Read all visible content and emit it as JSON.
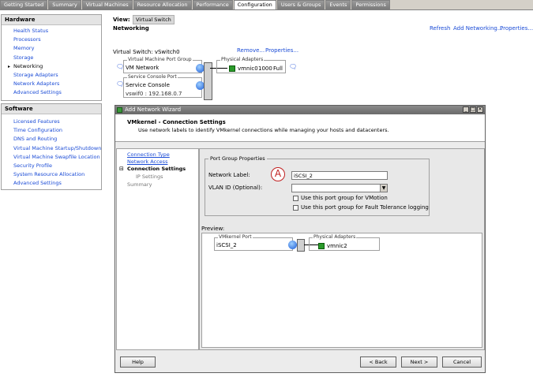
{
  "tabs": [
    "Getting Started",
    "Summary",
    "Virtual Machines",
    "Resource Allocation",
    "Performance",
    "Configuration",
    "Users & Groups",
    "Events",
    "Permissions"
  ],
  "active_tab": "Configuration",
  "hardware": {
    "title": "Hardware",
    "items": [
      "Health Status",
      "Processors",
      "Memory",
      "Storage",
      "Networking",
      "Storage Adapters",
      "Network Adapters",
      "Advanced Settings"
    ]
  },
  "software": {
    "title": "Software",
    "items": [
      "Licensed Features",
      "Time Configuration",
      "DNS and Routing",
      "Virtual Machine Startup/Shutdown",
      "Virtual Machine Swapfile Location",
      "Security Profile",
      "System Resource Allocation",
      "Advanced Settings"
    ]
  },
  "main": {
    "view_label": "View:",
    "view_value": "Virtual Switch",
    "section_title": "Networking",
    "refresh": "Refresh",
    "add_networking": "Add Networking...",
    "properties": "Properties...",
    "vswitch_label": "Virtual Switch: vSwitch0",
    "remove": "Remove...",
    "vswitch_properties": "Properties...",
    "vm_port_group_label": "Virtual Machine Port Group",
    "vm_network": "VM Network",
    "service_console_port_label": "Service Console Port",
    "service_console": "Service Console",
    "vswif": "vswif0 : 192.168.0.7",
    "physical_adapters_label": "Physical Adapters",
    "vmnic0": "vmnic0",
    "vmnic0_speed": "1000",
    "vmnic0_duplex": "Full"
  },
  "wizard": {
    "title": "Add Network Wizard",
    "header_title": "VMkernel - Connection Settings",
    "header_desc": "Use network labels to identify VMkernel connections while managing your hosts and datacenters.",
    "nav": {
      "connection_type": "Connection Type",
      "network_access": "Network Access",
      "connection_settings": "Connection Settings",
      "ip_settings": "IP Settings",
      "summary": "Summary"
    },
    "pgp_title": "Port Group Properties",
    "network_label_label": "Network Label:",
    "network_label_value": "iSCSI_2",
    "vlan_label": "VLAN ID (Optional):",
    "vlan_value": "",
    "vmotion_label": "Use this port group for VMotion",
    "ft_label": "Use this port group for Fault Tolerance logging",
    "marker": "A",
    "preview_title": "Preview:",
    "preview_vmkernel_port": "VMkernel Port",
    "preview_port_name": "iSCSI_2",
    "preview_physical_adapters": "Physical Adapters",
    "preview_vmnic": "vmnic2",
    "help": "Help",
    "back": "< Back",
    "next": "Next >",
    "cancel": "Cancel"
  }
}
